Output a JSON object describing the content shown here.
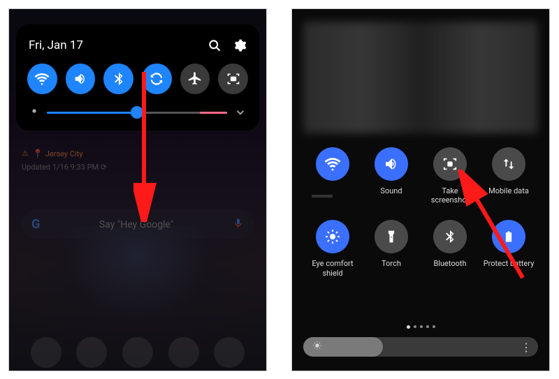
{
  "left": {
    "date": "Fri, Jan 17",
    "toggles": [
      {
        "name": "wifi",
        "on": true
      },
      {
        "name": "volume",
        "on": true
      },
      {
        "name": "bluetooth",
        "on": true
      },
      {
        "name": "autorotate",
        "on": true
      },
      {
        "name": "airplane",
        "on": false
      },
      {
        "name": "screenshot",
        "on": false
      }
    ],
    "brightness_percent": 50,
    "location_label": "Jersey City",
    "updated_label": "Updated 1/16 9:33 PM",
    "search_placeholder": "Say \"Hey Google\""
  },
  "right": {
    "tiles": [
      {
        "label": "",
        "name": "wifi",
        "on": true
      },
      {
        "label": "Sound",
        "name": "sound",
        "on": true
      },
      {
        "label": "Take screenshot",
        "name": "screenshot",
        "on": false
      },
      {
        "label": "Mobile data",
        "name": "mobile-data",
        "on": false
      },
      {
        "label": "Eye comfort shield",
        "name": "eye-comfort",
        "on": true
      },
      {
        "label": "Torch",
        "name": "torch",
        "on": false
      },
      {
        "label": "Bluetooth",
        "name": "bluetooth",
        "on": false
      },
      {
        "label": "Protect battery",
        "name": "protect-battery",
        "on": true
      }
    ],
    "brightness_percent": 34,
    "page_count": 5,
    "page_active": 0
  }
}
